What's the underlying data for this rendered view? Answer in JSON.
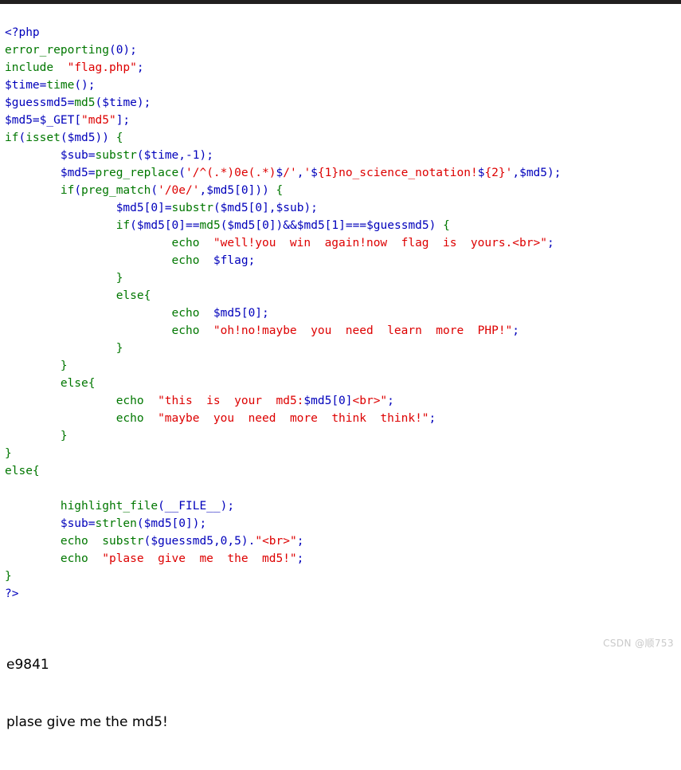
{
  "page": {
    "background_color": "#ffffff",
    "top_edge_color": "#221f1f"
  },
  "syntax_colors": {
    "keyword": "#007700",
    "string": "#dd0000",
    "variable": "#0000bb",
    "php_tag": "#0000bb",
    "default_text": "#000000",
    "watermark": "#c9c9c9"
  },
  "code": {
    "language": "php",
    "lines": [
      "<?php",
      "error_reporting(0);",
      "include  \"flag.php\";",
      "$time=time();",
      "$guessmd5=md5($time);",
      "$md5=$_GET[\"md5\"];",
      "if(isset($md5)) {",
      "        $sub=substr($time,-1);",
      "        $md5=preg_replace('/^(.*)0e(.*)$/','${1}no_science_notation!${2}',$md5);",
      "        if(preg_match('/0e/',$md5[0])) {",
      "                $md5[0]=substr($md5[0],$sub);",
      "                if($md5[0]==md5($md5[0])&&$md5[1]===$guessmd5) {",
      "                        echo  \"well!you  win  again!now  flag  is  yours.<br>\";",
      "                        echo  $flag;",
      "                }",
      "                else{",
      "                        echo  $md5[0];",
      "                        echo  \"oh!no!maybe  you  need  learn  more  PHP!\";",
      "                }",
      "        }",
      "        else{",
      "                echo  \"this  is  your  md5:$md5[0]<br>\";",
      "                echo  \"maybe  you  need  more  think  think!\";",
      "        }",
      "}",
      "else{",
      "        highlight_file(__FILE__);",
      "        $sub=strlen($md5[0]);",
      "        echo  substr($guessmd5,0,5).\"<br>\";",
      "        echo  \"plase  give  me  the  md5!\";",
      "}",
      "?>"
    ]
  },
  "output": {
    "lines": [
      "e9841",
      "plase give me the md5!"
    ],
    "guess_md5_prefix": "e9841",
    "message": "plase give me the md5!"
  },
  "watermark": {
    "text": "CSDN @顺753"
  }
}
